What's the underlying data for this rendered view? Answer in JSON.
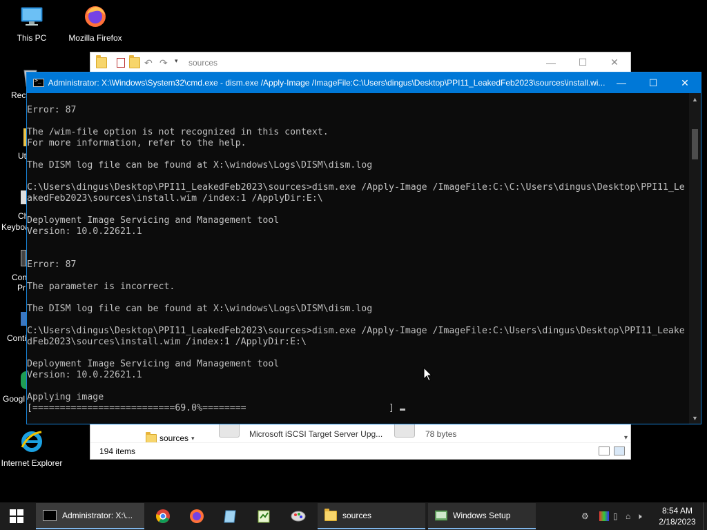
{
  "desktop": {
    "icons": [
      {
        "label": "This PC",
        "icon": "this-pc-icon"
      },
      {
        "label": "Mozilla Firefox",
        "icon": "firefox-icon"
      },
      {
        "label": "Internet Explorer",
        "icon": "internet-explorer-icon"
      }
    ],
    "partial_labels": [
      "Recy",
      "Ut",
      "Ch",
      "Keyboa",
      "Con",
      "Pr",
      "Conti",
      "Googl"
    ]
  },
  "explorer": {
    "title": "sources",
    "nav_folder": "sources",
    "file1_name": "Microsoft iSCSI Target Server Upg...",
    "file2_size": "78 bytes",
    "status": "194 items"
  },
  "cmd": {
    "title": "Administrator: X:\\Windows\\System32\\cmd.exe - dism.exe  /Apply-Image /ImageFile:C:\\Users\\dingus\\Desktop\\PPI11_LeakedFeb2023\\sources\\install.wi...",
    "lines": [
      "",
      "Error: 87",
      "",
      "The /wim-file option is not recognized in this context.",
      "For more information, refer to the help.",
      "",
      "The DISM log file can be found at X:\\windows\\Logs\\DISM\\dism.log",
      "",
      "C:\\Users\\dingus\\Desktop\\PPI11_LeakedFeb2023\\sources>dism.exe /Apply-Image /ImageFile:C:\\C:\\Users\\dingus\\Desktop\\PPI11_Le",
      "akedFeb2023\\sources\\install.wim /index:1 /ApplyDir:E:\\",
      "",
      "Deployment Image Servicing and Management tool",
      "Version: 10.0.22621.1",
      "",
      "",
      "Error: 87",
      "",
      "The parameter is incorrect.",
      "",
      "The DISM log file can be found at X:\\windows\\Logs\\DISM\\dism.log",
      "",
      "C:\\Users\\dingus\\Desktop\\PPI11_LeakedFeb2023\\sources>dism.exe /Apply-Image /ImageFile:C:\\Users\\dingus\\Desktop\\PPI11_Leake",
      "dFeb2023\\sources\\install.wim /index:1 /ApplyDir:E:\\",
      "",
      "Deployment Image Servicing and Management tool",
      "Version: 10.0.22621.1",
      "",
      "Applying image"
    ],
    "progress_line": "[==========================69.0%========                          ]",
    "progress_percent": 69.0
  },
  "taskbar": {
    "apps": [
      {
        "label": "Administrator: X:\\...",
        "icon": "cmd-icon"
      },
      {
        "label": "sources",
        "icon": "folder-icon"
      },
      {
        "label": "Windows Setup",
        "icon": "windows-setup-icon"
      }
    ],
    "pinned": [
      "chrome-icon",
      "firefox-icon",
      "notepad-icon",
      "notepad-plus-icon",
      "paint-icon"
    ],
    "time": "8:54 AM",
    "date": "2/18/2023"
  }
}
